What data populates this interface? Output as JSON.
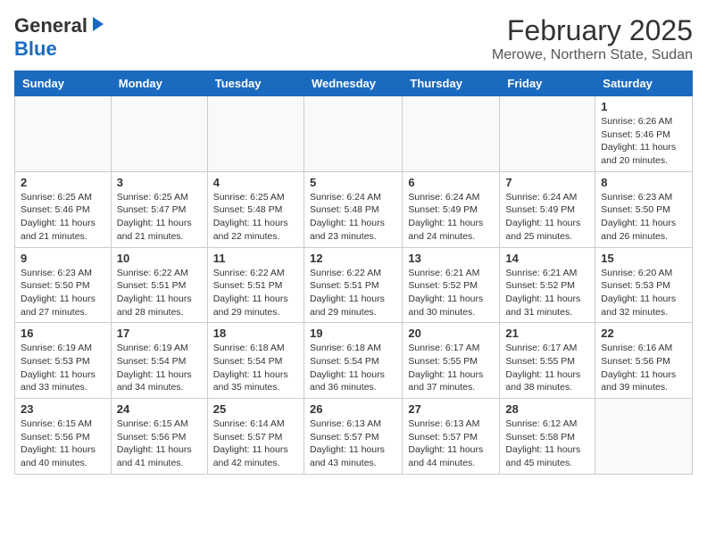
{
  "header": {
    "logo_general": "General",
    "logo_blue": "Blue",
    "month_title": "February 2025",
    "location": "Merowe, Northern State, Sudan"
  },
  "days_of_week": [
    "Sunday",
    "Monday",
    "Tuesday",
    "Wednesday",
    "Thursday",
    "Friday",
    "Saturday"
  ],
  "weeks": [
    [
      {
        "day": "",
        "info": ""
      },
      {
        "day": "",
        "info": ""
      },
      {
        "day": "",
        "info": ""
      },
      {
        "day": "",
        "info": ""
      },
      {
        "day": "",
        "info": ""
      },
      {
        "day": "",
        "info": ""
      },
      {
        "day": "1",
        "info": "Sunrise: 6:26 AM\nSunset: 5:46 PM\nDaylight: 11 hours and 20 minutes."
      }
    ],
    [
      {
        "day": "2",
        "info": "Sunrise: 6:25 AM\nSunset: 5:46 PM\nDaylight: 11 hours and 21 minutes."
      },
      {
        "day": "3",
        "info": "Sunrise: 6:25 AM\nSunset: 5:47 PM\nDaylight: 11 hours and 21 minutes."
      },
      {
        "day": "4",
        "info": "Sunrise: 6:25 AM\nSunset: 5:48 PM\nDaylight: 11 hours and 22 minutes."
      },
      {
        "day": "5",
        "info": "Sunrise: 6:24 AM\nSunset: 5:48 PM\nDaylight: 11 hours and 23 minutes."
      },
      {
        "day": "6",
        "info": "Sunrise: 6:24 AM\nSunset: 5:49 PM\nDaylight: 11 hours and 24 minutes."
      },
      {
        "day": "7",
        "info": "Sunrise: 6:24 AM\nSunset: 5:49 PM\nDaylight: 11 hours and 25 minutes."
      },
      {
        "day": "8",
        "info": "Sunrise: 6:23 AM\nSunset: 5:50 PM\nDaylight: 11 hours and 26 minutes."
      }
    ],
    [
      {
        "day": "9",
        "info": "Sunrise: 6:23 AM\nSunset: 5:50 PM\nDaylight: 11 hours and 27 minutes."
      },
      {
        "day": "10",
        "info": "Sunrise: 6:22 AM\nSunset: 5:51 PM\nDaylight: 11 hours and 28 minutes."
      },
      {
        "day": "11",
        "info": "Sunrise: 6:22 AM\nSunset: 5:51 PM\nDaylight: 11 hours and 29 minutes."
      },
      {
        "day": "12",
        "info": "Sunrise: 6:22 AM\nSunset: 5:51 PM\nDaylight: 11 hours and 29 minutes."
      },
      {
        "day": "13",
        "info": "Sunrise: 6:21 AM\nSunset: 5:52 PM\nDaylight: 11 hours and 30 minutes."
      },
      {
        "day": "14",
        "info": "Sunrise: 6:21 AM\nSunset: 5:52 PM\nDaylight: 11 hours and 31 minutes."
      },
      {
        "day": "15",
        "info": "Sunrise: 6:20 AM\nSunset: 5:53 PM\nDaylight: 11 hours and 32 minutes."
      }
    ],
    [
      {
        "day": "16",
        "info": "Sunrise: 6:19 AM\nSunset: 5:53 PM\nDaylight: 11 hours and 33 minutes."
      },
      {
        "day": "17",
        "info": "Sunrise: 6:19 AM\nSunset: 5:54 PM\nDaylight: 11 hours and 34 minutes."
      },
      {
        "day": "18",
        "info": "Sunrise: 6:18 AM\nSunset: 5:54 PM\nDaylight: 11 hours and 35 minutes."
      },
      {
        "day": "19",
        "info": "Sunrise: 6:18 AM\nSunset: 5:54 PM\nDaylight: 11 hours and 36 minutes."
      },
      {
        "day": "20",
        "info": "Sunrise: 6:17 AM\nSunset: 5:55 PM\nDaylight: 11 hours and 37 minutes."
      },
      {
        "day": "21",
        "info": "Sunrise: 6:17 AM\nSunset: 5:55 PM\nDaylight: 11 hours and 38 minutes."
      },
      {
        "day": "22",
        "info": "Sunrise: 6:16 AM\nSunset: 5:56 PM\nDaylight: 11 hours and 39 minutes."
      }
    ],
    [
      {
        "day": "23",
        "info": "Sunrise: 6:15 AM\nSunset: 5:56 PM\nDaylight: 11 hours and 40 minutes."
      },
      {
        "day": "24",
        "info": "Sunrise: 6:15 AM\nSunset: 5:56 PM\nDaylight: 11 hours and 41 minutes."
      },
      {
        "day": "25",
        "info": "Sunrise: 6:14 AM\nSunset: 5:57 PM\nDaylight: 11 hours and 42 minutes."
      },
      {
        "day": "26",
        "info": "Sunrise: 6:13 AM\nSunset: 5:57 PM\nDaylight: 11 hours and 43 minutes."
      },
      {
        "day": "27",
        "info": "Sunrise: 6:13 AM\nSunset: 5:57 PM\nDaylight: 11 hours and 44 minutes."
      },
      {
        "day": "28",
        "info": "Sunrise: 6:12 AM\nSunset: 5:58 PM\nDaylight: 11 hours and 45 minutes."
      },
      {
        "day": "",
        "info": ""
      }
    ]
  ]
}
